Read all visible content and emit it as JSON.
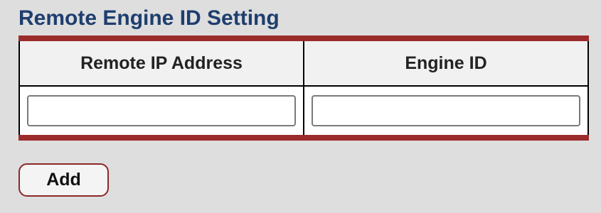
{
  "page": {
    "title": "Remote Engine ID Setting"
  },
  "table": {
    "columns": [
      "Remote IP Address",
      "Engine ID"
    ],
    "rows": [
      {
        "remote_ip_value": "",
        "engine_id_value": ""
      }
    ]
  },
  "actions": {
    "add_label": "Add"
  },
  "colors": {
    "title": "#1e3e6e",
    "accent_border": "#9b2c2c",
    "background": "#dedede"
  }
}
